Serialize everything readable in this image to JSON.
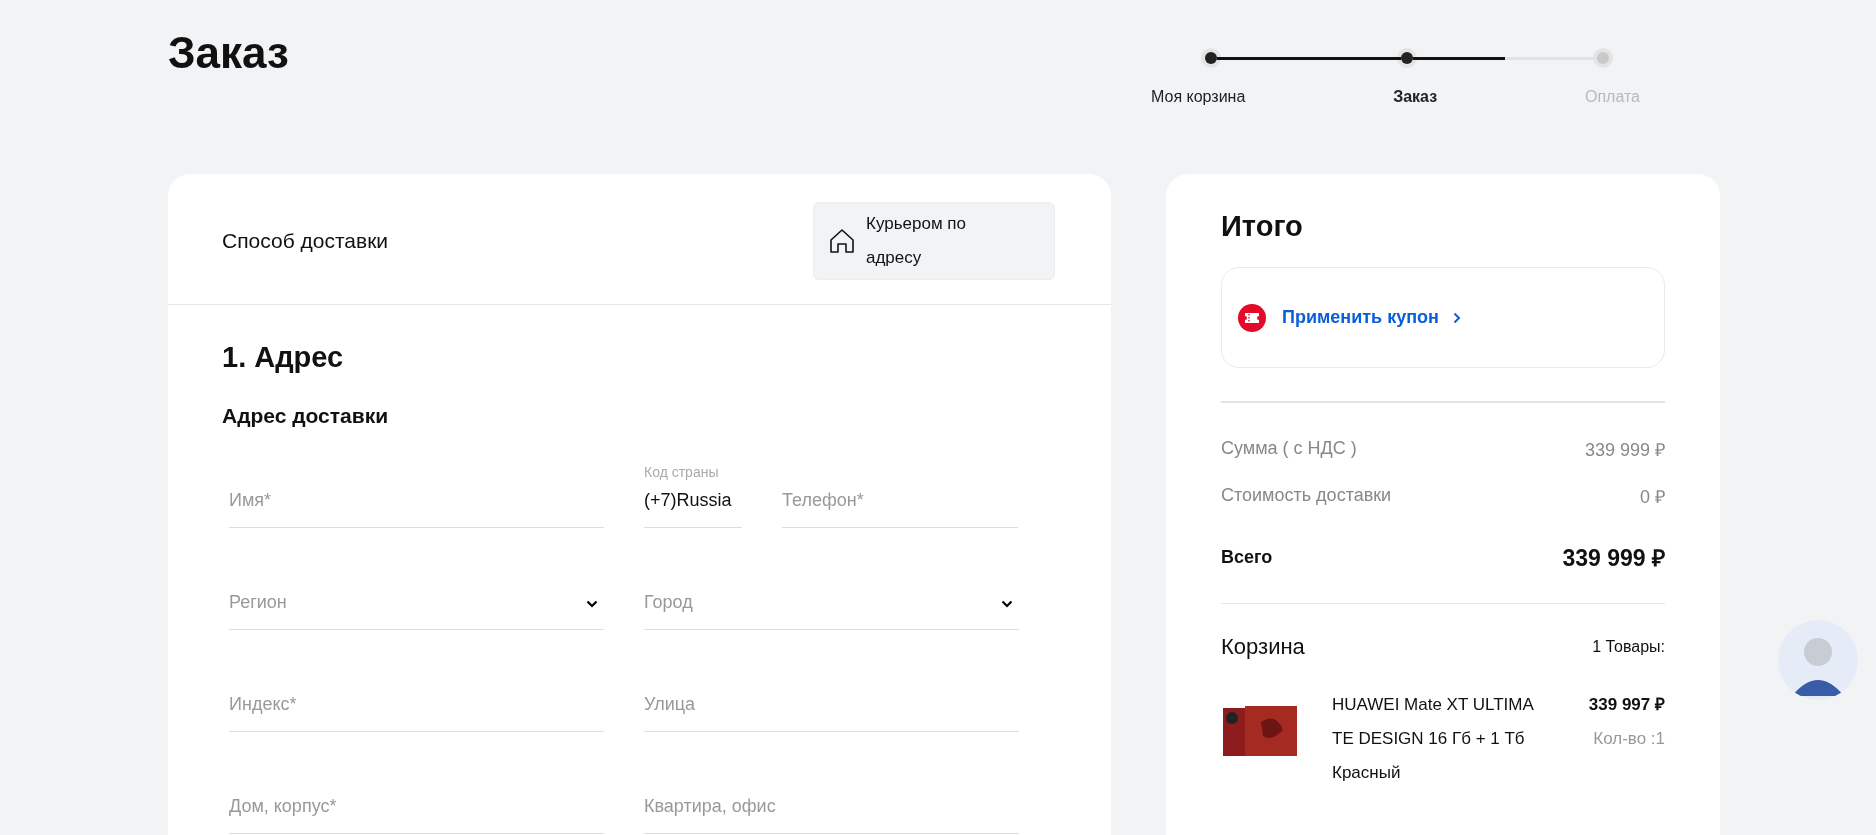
{
  "page_title": "Заказ",
  "steps": [
    {
      "label": "Моя корзина",
      "completed": true,
      "selected": false
    },
    {
      "label": "Заказ",
      "completed": true,
      "selected": true
    },
    {
      "label": "Оплата",
      "completed": false,
      "selected": false
    }
  ],
  "delivery": {
    "label": "Способ доставки",
    "option": "Курьером по адресу"
  },
  "address": {
    "section_title": "1. Адрес",
    "subtitle": "Адрес доставки",
    "rows": [
      [
        {
          "kind": "text",
          "placeholder": "Имя*"
        },
        {
          "kind": "code",
          "label": "Код страны",
          "value": "(+7)Russia"
        },
        {
          "kind": "text",
          "placeholder": "Телефон*"
        }
      ],
      [
        {
          "kind": "select",
          "placeholder": "Регион"
        },
        {
          "kind": "select",
          "placeholder": "Город"
        }
      ],
      [
        {
          "kind": "text",
          "placeholder": "Индекс*"
        },
        {
          "kind": "text",
          "placeholder": "Улица"
        }
      ],
      [
        {
          "kind": "text",
          "placeholder": "Дом, корпус*"
        },
        {
          "kind": "text",
          "placeholder": "Квартира, офис"
        }
      ]
    ]
  },
  "summary": {
    "title": "Итого",
    "coupon": "Применить купон",
    "lines": [
      {
        "label": "Сумма ( с НДС )",
        "value": "339 999 ₽"
      },
      {
        "label": "Стоимость доставки",
        "value": "0 ₽"
      }
    ],
    "total": {
      "label": "Всего",
      "value": "339 999 ₽"
    },
    "cart": {
      "title": "Корзина",
      "count": "1 Товары:",
      "items": [
        {
          "name": "HUAWEI Mate XT ULTIMATE DESIGN 16 Гб + 1 Тб Красный",
          "price": "339 997 ₽",
          "qty": "Кол-во :1"
        }
      ]
    }
  }
}
